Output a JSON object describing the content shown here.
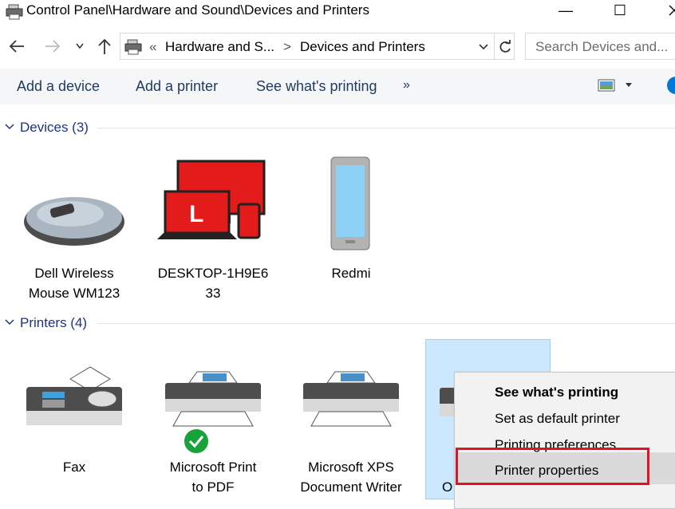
{
  "window": {
    "title": "Control Panel\\Hardware and Sound\\Devices and Printers",
    "minimize": "—",
    "maximize": "☐"
  },
  "nav": {
    "path_sep1": "«",
    "crumb1": "Hardware and S...",
    "path_sep2": ">",
    "crumb2": "Devices and Printers",
    "search_placeholder": "Search Devices and..."
  },
  "toolbar": {
    "add_device": "Add a device",
    "add_printer": "Add a printer",
    "see_printing": "See what's printing",
    "more": "»"
  },
  "groups": {
    "devices": "Devices (3)",
    "printers": "Printers (4)"
  },
  "devices": [
    {
      "line1": "Dell Wireless",
      "line2": "Mouse WM123"
    },
    {
      "line1": "DESKTOP-1H9E6",
      "line2": "33"
    },
    {
      "line1": "Redmi",
      "line2": ""
    }
  ],
  "printers": [
    {
      "line1": "Fax",
      "line2": ""
    },
    {
      "line1": "Microsoft Print",
      "line2": "to PDF"
    },
    {
      "line1": "Microsoft XPS",
      "line2": "Document Writer"
    },
    {
      "line1": "O",
      "line2": ""
    }
  ],
  "context_menu": {
    "items": [
      "See what's printing",
      "Set as default printer",
      "Printing preferences",
      "Printer properties"
    ]
  },
  "colors": {
    "accent": "#1e3287",
    "selection": "#cce8ff",
    "highlight_box": "#e81123"
  }
}
